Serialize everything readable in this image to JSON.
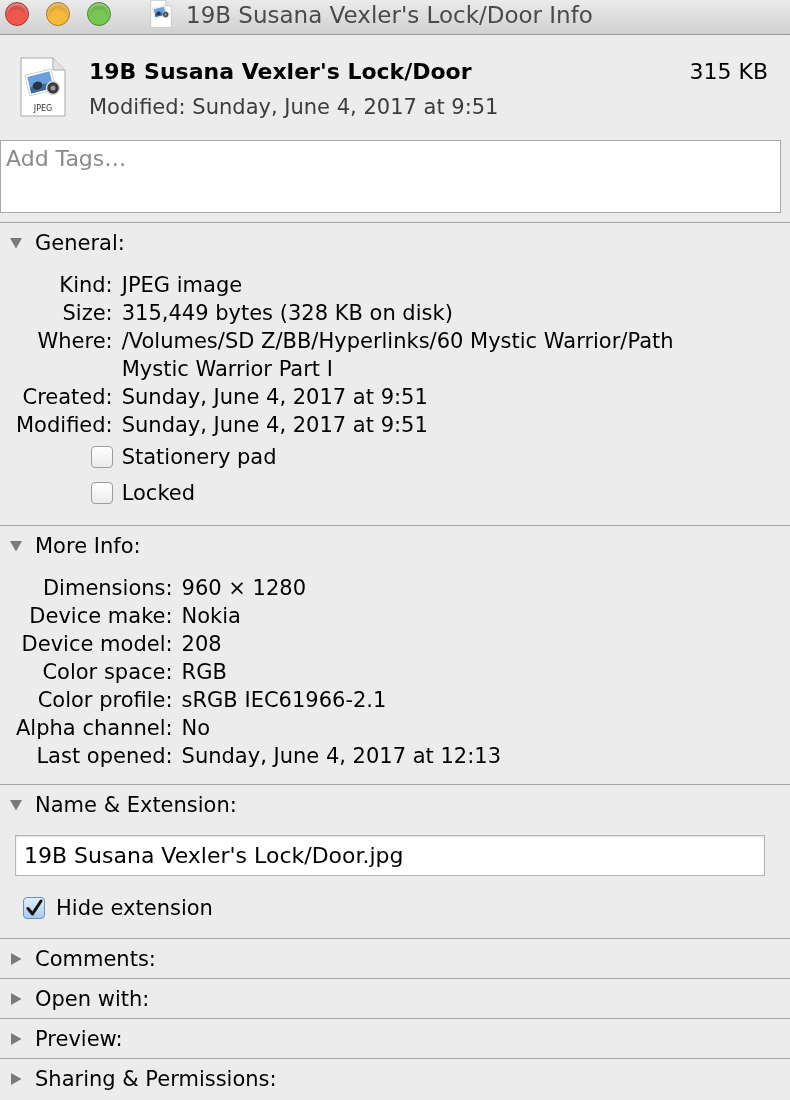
{
  "window": {
    "title": "19B Susana Vexler's Lock/Door Info"
  },
  "header": {
    "icon_label": "JPEG",
    "name": "19B Susana Vexler's Lock/Door",
    "size": "315 KB",
    "modified": "Modified: Sunday, June 4, 2017 at 9:51"
  },
  "tags": {
    "placeholder": "Add Tags…"
  },
  "sections": [
    {
      "title": "General:",
      "expanded": true,
      "rows": [
        {
          "label": "Kind:",
          "value": "JPEG image"
        },
        {
          "label": "Size:",
          "value": "315,449 bytes (328 KB on disk)"
        },
        {
          "label": "Where:",
          "value": "/Volumes/SD Z/BB/Hyperlinks/60 Mystic Warrior/Path Mystic Warrior Part I"
        },
        {
          "label": "Created:",
          "value": "Sunday, June 4, 2017 at 9:51"
        },
        {
          "label": "Modified:",
          "value": "Sunday, June 4, 2017 at 9:51"
        }
      ],
      "checkboxes": [
        {
          "label": "Stationery pad",
          "checked": false
        },
        {
          "label": "Locked",
          "checked": false
        }
      ]
    },
    {
      "title": "More Info:",
      "expanded": true,
      "rows": [
        {
          "label": "Dimensions:",
          "value": "960 × 1280"
        },
        {
          "label": "Device make:",
          "value": "Nokia"
        },
        {
          "label": "Device model:",
          "value": "208"
        },
        {
          "label": "Color space:",
          "value": "RGB"
        },
        {
          "label": "Color profile:",
          "value": "sRGB IEC61966-2.1"
        },
        {
          "label": "Alpha channel:",
          "value": "No"
        },
        {
          "label": "Last opened:",
          "value": "Sunday, June 4, 2017 at 12:13"
        }
      ]
    },
    {
      "title": "Name & Extension:",
      "expanded": true,
      "field": {
        "value": "19B Susana Vexler's Lock/Door.jpg"
      },
      "checkboxes": [
        {
          "label": "Hide extension",
          "checked": true
        }
      ]
    },
    {
      "title": "Comments:",
      "expanded": false
    },
    {
      "title": "Open with:",
      "expanded": false
    },
    {
      "title": "Preview:",
      "expanded": false
    },
    {
      "title": "Sharing & Permissions:",
      "expanded": false
    }
  ]
}
